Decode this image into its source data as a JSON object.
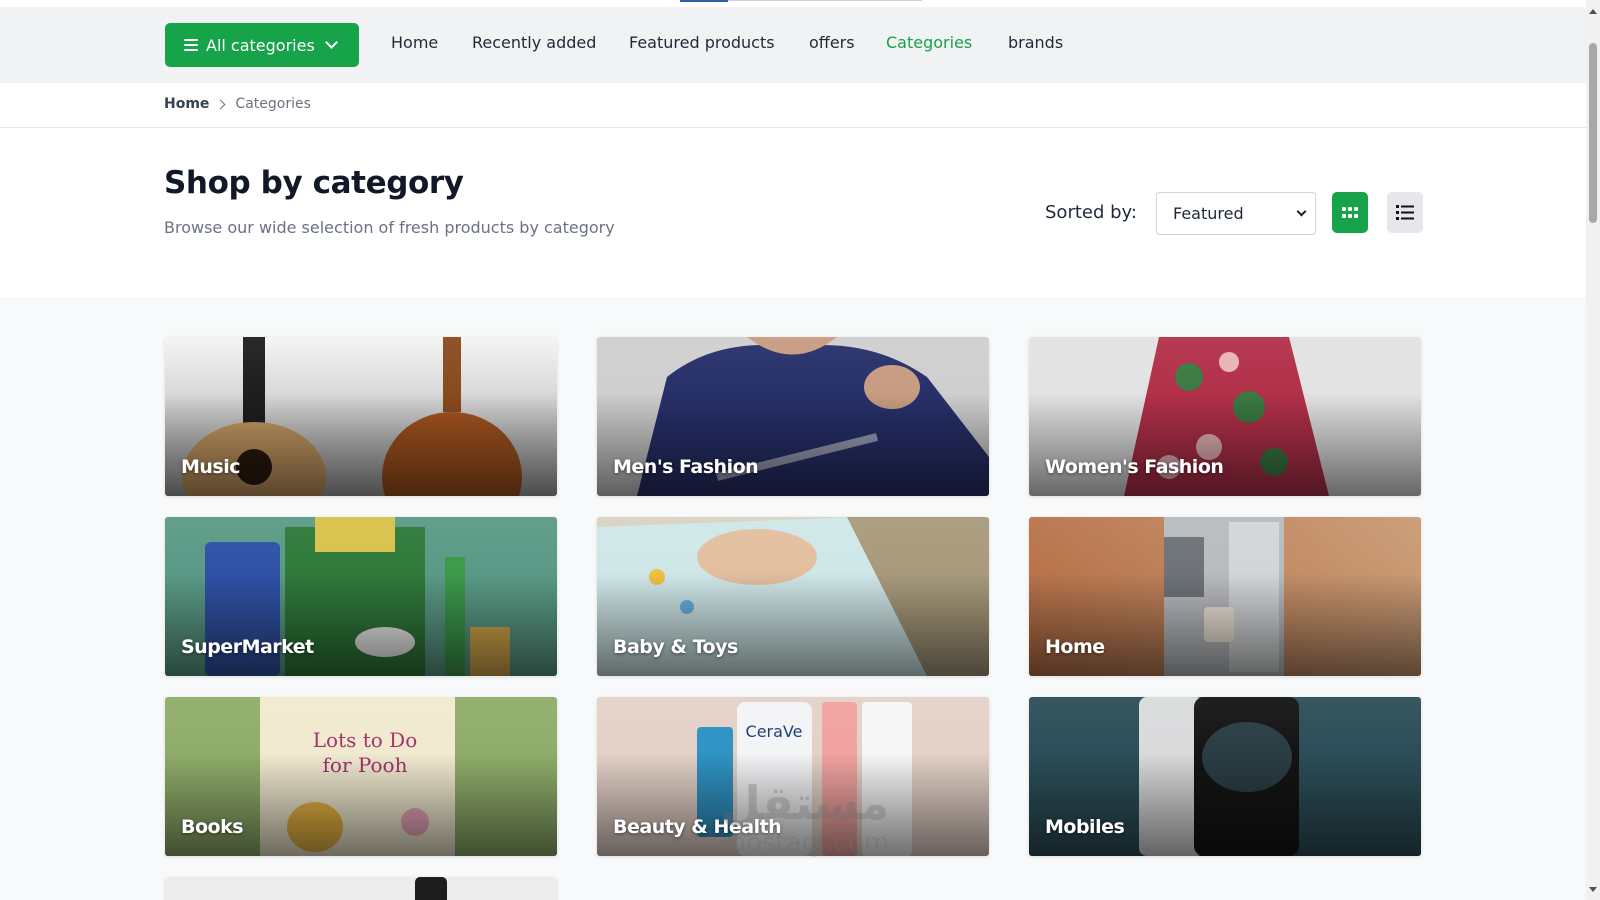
{
  "nav": {
    "all_categories": "All categories",
    "links": [
      "Home",
      "Recently added",
      "Featured products",
      "offers",
      "Categories",
      "brands"
    ],
    "active": "Categories"
  },
  "breadcrumb": {
    "home": "Home",
    "current": "Categories"
  },
  "header": {
    "title": "Shop by category",
    "subtitle": "Browse our wide selection of fresh products by category"
  },
  "sort": {
    "label": "Sorted by:",
    "selected": "Featured",
    "view_mode": "grid"
  },
  "categories": [
    {
      "name": "Music",
      "icon": "guitar"
    },
    {
      "name": "Men's Fashion",
      "icon": "hoodie"
    },
    {
      "name": "Women's Fashion",
      "icon": "floral-dress"
    },
    {
      "name": "SuperMarket",
      "icon": "groceries"
    },
    {
      "name": "Baby & Toys",
      "icon": "diapers"
    },
    {
      "name": "Home",
      "icon": "coffee-machine"
    },
    {
      "name": "Books",
      "icon": "book"
    },
    {
      "name": "Beauty & Health",
      "icon": "skincare-bottles"
    },
    {
      "name": "Mobiles",
      "icon": "smartphone"
    },
    {
      "name": "",
      "icon": "product"
    }
  ],
  "watermark": {
    "arabic": "مستقل",
    "latin": "mostaql.com"
  },
  "colors": {
    "accent": "#16a34a",
    "text": "#1f2937",
    "muted": "#6b7280",
    "nav_bg": "#f1f2f3"
  }
}
